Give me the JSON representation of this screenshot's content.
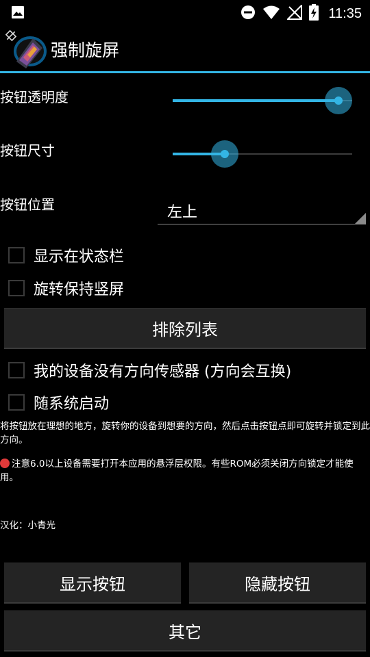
{
  "status_bar": {
    "time": "11:35",
    "icons": [
      "image-icon",
      "do-not-disturb-icon",
      "wifi-icon",
      "no-signal-icon",
      "battery-charging-icon"
    ]
  },
  "app_bar": {
    "title": "强制旋屏",
    "icon": "app-rotate-icon"
  },
  "settings": {
    "opacity": {
      "label": "按钮透明度",
      "value_fraction": 1.0
    },
    "size": {
      "label": "按钮尺寸",
      "value_fraction": 0.25
    },
    "position": {
      "label": "按钮位置",
      "selected": "左上"
    }
  },
  "checkboxes": {
    "show_in_status_bar": {
      "label": "显示在状态栏",
      "checked": false
    },
    "keep_portrait": {
      "label": "旋转保持竖屏",
      "checked": false
    },
    "no_sensor": {
      "label": "我的设备没有方向传感器 (方向会互换)",
      "checked": false
    },
    "autostart": {
      "label": "随系统启动",
      "checked": false
    }
  },
  "buttons": {
    "exclude_list": "排除列表",
    "show_button": "显示按钮",
    "hide_button": "隐藏按钮",
    "other": "其它"
  },
  "info": {
    "instructions": "将按钮放在理想的地方，旋转你的设备到想要的方向，然后点击按钮点即可旋转并锁定到此方向。",
    "note": "注意6.0以上设备需要打开本应用的悬浮层权限。有些ROM必须关闭方向锁定才能使用。",
    "credit": "汉化：小青光"
  },
  "colors": {
    "accent": "#33b5e5",
    "background": "#000000",
    "button_bg": "#242424",
    "warning_dot": "#e23a3a"
  }
}
